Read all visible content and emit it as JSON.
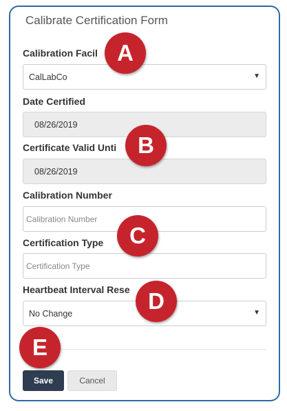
{
  "form": {
    "title": "Calibrate Certification Form",
    "calibration_facility": {
      "label": "Calibration Facil",
      "value": "CalLabCo"
    },
    "date_certified": {
      "label": "Date Certified",
      "value": "08/26/2019"
    },
    "certificate_valid_until": {
      "label": "Certificate Valid Unti",
      "value": "08/26/2019"
    },
    "calibration_number": {
      "label": "Calibration Number",
      "placeholder": "Calibration Number"
    },
    "certification_type": {
      "label": "Certification Type",
      "placeholder": "Certification Type"
    },
    "heartbeat_interval_reset": {
      "label": "Heartbeat Interval Rese",
      "value": "No Change"
    },
    "save_label": "Save",
    "cancel_label": "Cancel"
  },
  "callouts": [
    "A",
    "B",
    "C",
    "D",
    "E"
  ],
  "icons": {
    "dropdown": "caret-down-icon"
  },
  "colors": {
    "border": "#2d6aa5",
    "callout": "#c6242c",
    "save_button": "#2e3d4f"
  }
}
